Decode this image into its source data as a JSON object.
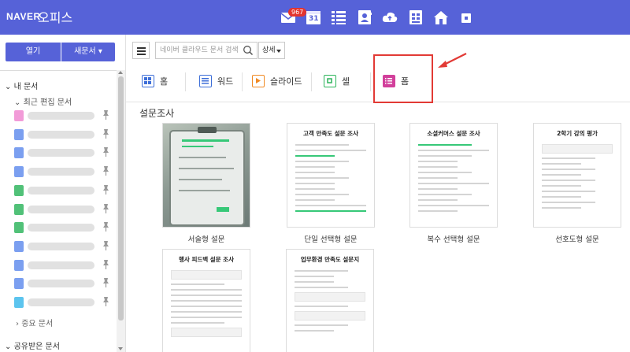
{
  "header": {
    "brand": "NAVER",
    "product": "오피스",
    "mail_badge": "967",
    "calendar_day": "31",
    "apps": [
      "mail-icon",
      "calendar-icon",
      "list-icon",
      "contacts-icon",
      "cloud-icon",
      "office-icon",
      "home-icon",
      "more-icon"
    ]
  },
  "sidebar": {
    "open_label": "열기",
    "new_doc_label": "새문서 ▾",
    "my_docs_label": "내 문서",
    "recent_label": "최근 편집 문서",
    "recent_doc_colors": [
      "#f29bd8",
      "#7b9ff0",
      "#7b9ff0",
      "#7b9ff0",
      "#51c178",
      "#51c178",
      "#51c178",
      "#7b9ff0",
      "#7b9ff0",
      "#7b9ff0",
      "#5cc4ee"
    ],
    "favorites_label": "중요 문서",
    "shared_label": "공유받은 문서"
  },
  "toolbar": {
    "search_placeholder": "네이버 클라우드 문서 검색",
    "detail_label": "상세"
  },
  "tabs": [
    {
      "label": "홈",
      "color": "#3d6ed8"
    },
    {
      "label": "워드",
      "color": "#3d6ed8"
    },
    {
      "label": "슬라이드",
      "color": "#f08a24"
    },
    {
      "label": "셀",
      "color": "#2bb45a"
    },
    {
      "label": "폼",
      "color": "#d2409b"
    }
  ],
  "gallery": {
    "section_title": "설문조사",
    "templates": [
      {
        "caption": "서술형 설문",
        "title": "",
        "photo": true
      },
      {
        "caption": "단일 선택형 설문",
        "title": "고객 만족도 설문 조사"
      },
      {
        "caption": "복수 선택형 설문",
        "title": "소셜커머스 설문 조사"
      },
      {
        "caption": "선호도형 설문",
        "title": "2학기 강의 평가"
      },
      {
        "caption": "",
        "title": "행사 피드백 설문 조사"
      },
      {
        "caption": "",
        "title": "업무환경 만족도 설문지"
      }
    ]
  },
  "colors": {
    "brand_blue": "#5662d8",
    "highlight_red": "#e23a35"
  }
}
